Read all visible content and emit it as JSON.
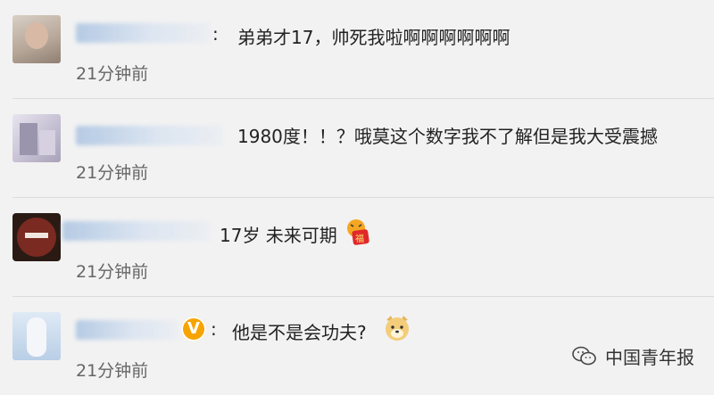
{
  "comments": [
    {
      "text": "弟弟才17，帅死我啦啊啊啊啊啊啊",
      "time": "21分钟前"
    },
    {
      "text": "1980度！！？哦莫这个数字我不了解但是我大受震撼",
      "time": "21分钟前"
    },
    {
      "text": "17岁  未来可期",
      "time": "21分钟前",
      "emoji": "tiger-fu-emoji"
    },
    {
      "text": "他是不是会功夫?",
      "time": "21分钟前",
      "badge": "V",
      "emoji": "doge-emoji"
    }
  ],
  "colon": ":",
  "watermark": {
    "text": "中国青年报",
    "icon": "wechat-icon"
  }
}
